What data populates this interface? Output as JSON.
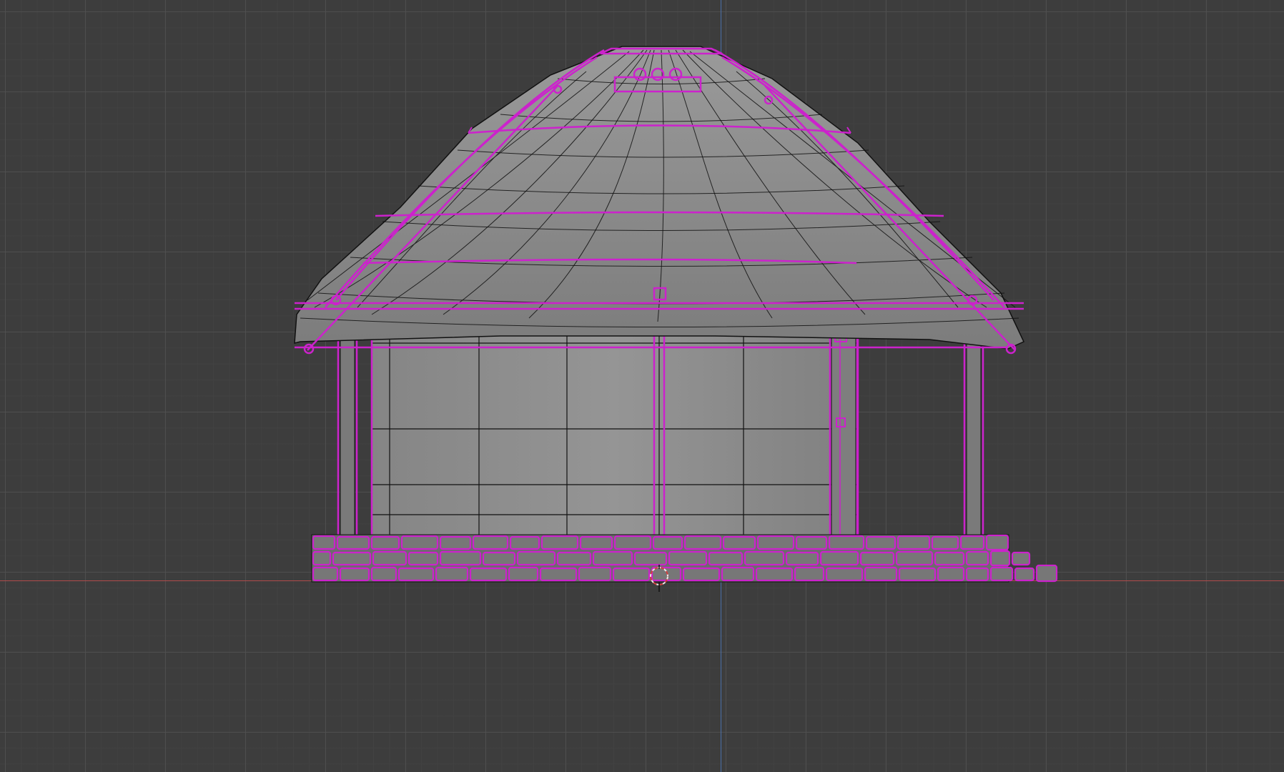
{
  "viewport": {
    "view": "front-orthographic",
    "grid": true,
    "colors": {
      "background": "#3d3d3d",
      "grid_major": "#505050",
      "grid_minor": "#434343",
      "axis_x": "#b04a4a",
      "axis_z": "#4a6fa8",
      "selection_outline": "#cc22cc",
      "mesh_wire": "#111111",
      "mesh_fill": "#8a8a8a"
    }
  },
  "scene": {
    "object": "hut-model",
    "selected": true,
    "parts": [
      "thatched-roof",
      "walls",
      "door-frame",
      "support-posts",
      "stone-foundation"
    ],
    "origin_marker": "3d-cursor-icon"
  }
}
